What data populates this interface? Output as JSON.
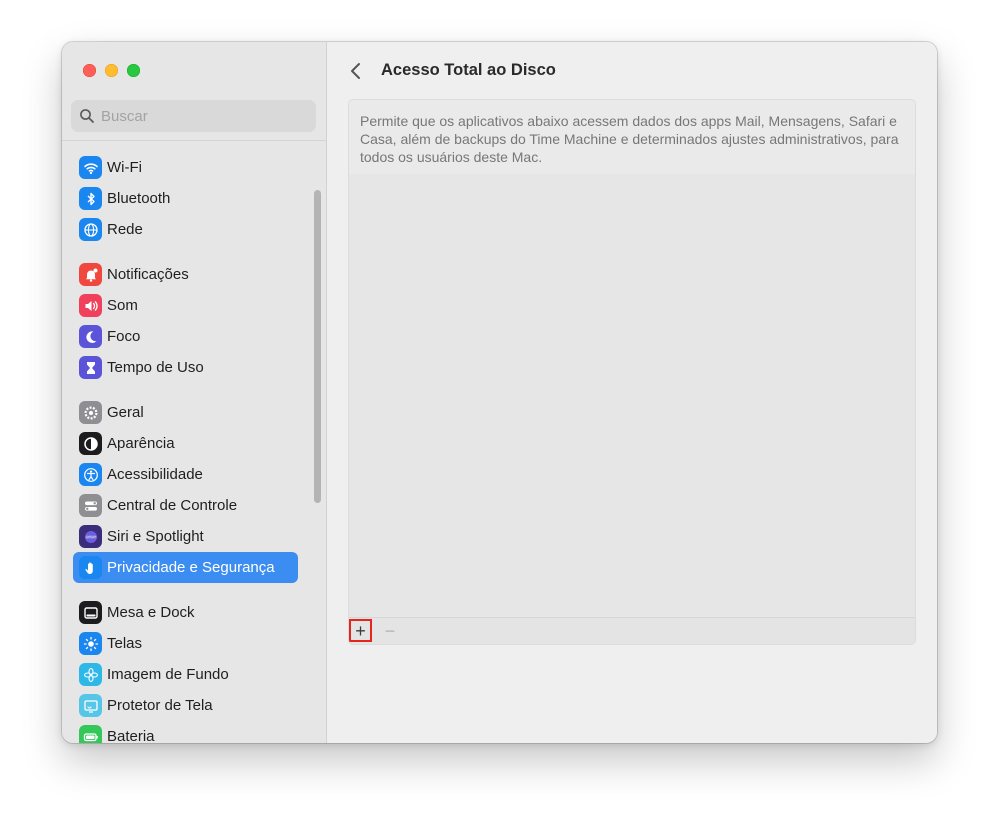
{
  "window": {
    "title": "Acesso Total ao Disco"
  },
  "search": {
    "placeholder": "Buscar"
  },
  "sidebar": {
    "items": [
      {
        "label": "Wi-Fi",
        "icon": "wifi-icon",
        "color": "#1a86f0"
      },
      {
        "label": "Bluetooth",
        "icon": "bluetooth-icon",
        "color": "#1a86f0"
      },
      {
        "label": "Rede",
        "icon": "globe-icon",
        "color": "#1a86f0"
      },
      {
        "label": "Notificações",
        "icon": "bell-icon",
        "color": "#f0483e"
      },
      {
        "label": "Som",
        "icon": "speaker-icon",
        "color": "#f0405c"
      },
      {
        "label": "Foco",
        "icon": "moon-icon",
        "color": "#5b53d8"
      },
      {
        "label": "Tempo de Uso",
        "icon": "hourglass-icon",
        "color": "#5b53d8"
      },
      {
        "label": "Geral",
        "icon": "gear-icon",
        "color": "#8e8e93"
      },
      {
        "label": "Aparência",
        "icon": "appearance-icon",
        "color": "#1c1c1e"
      },
      {
        "label": "Acessibilidade",
        "icon": "accessibility-icon",
        "color": "#1a86f0"
      },
      {
        "label": "Central de Controle",
        "icon": "control-center-icon",
        "color": "#8e8e93"
      },
      {
        "label": "Siri e Spotlight",
        "icon": "siri-icon",
        "color": "#3a2d7a"
      },
      {
        "label": "Privacidade e Segurança",
        "icon": "hand-icon",
        "color": "#1a86f0",
        "selected": true
      },
      {
        "label": "Mesa e Dock",
        "icon": "dock-icon",
        "color": "#1c1c1e"
      },
      {
        "label": "Telas",
        "icon": "sun-icon",
        "color": "#1a86f0"
      },
      {
        "label": "Imagem de Fundo",
        "icon": "flower-icon",
        "color": "#2db8e8"
      },
      {
        "label": "Protetor de Tela",
        "icon": "screensaver-icon",
        "color": "#55c6e8"
      },
      {
        "label": "Bateria",
        "icon": "battery-icon",
        "color": "#34c759"
      }
    ]
  },
  "main": {
    "back_label": "‹",
    "description": "Permite que os aplicativos abaixo acessem dados dos apps Mail, Mensagens, Safari e Casa, além de backups do Time Machine e determinados ajustes administrativos, para todos os usuários deste Mac.",
    "add_label": "+",
    "remove_label": "−"
  },
  "colors": {
    "accent": "#3b8df1",
    "highlight_border": "#e6261c"
  }
}
